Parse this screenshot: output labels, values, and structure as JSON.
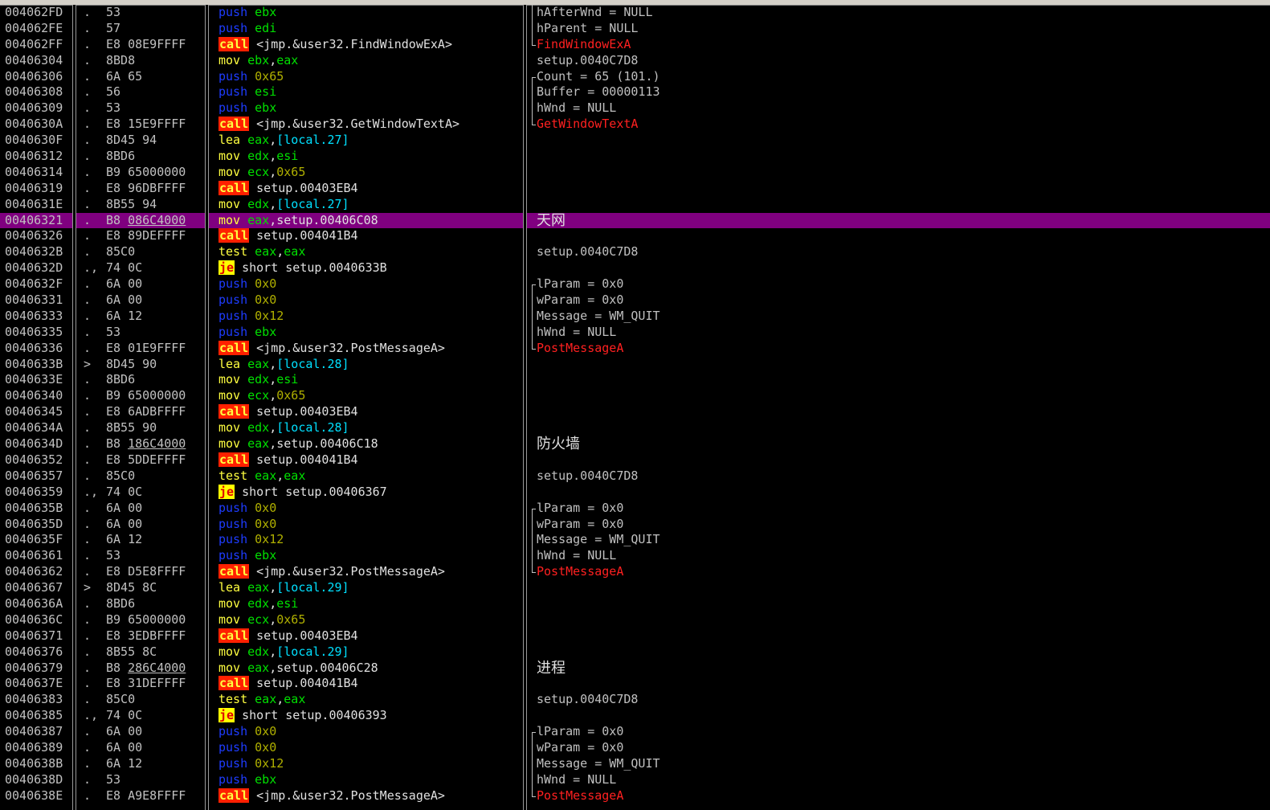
{
  "rows": [
    {
      "addr": "004062FD",
      "mark": ".",
      "hex": "53",
      "ul": "",
      "mn": "push",
      "ops": [
        [
          "reg",
          "ebx"
        ]
      ],
      "cmt": "hAfterWnd = NULL",
      "ct": "txt",
      "br": "mid"
    },
    {
      "addr": "004062FE",
      "mark": ".",
      "hex": "57",
      "ul": "",
      "mn": "push",
      "ops": [
        [
          "reg",
          "edi"
        ]
      ],
      "cmt": "hParent = NULL",
      "ct": "txt",
      "br": "mid"
    },
    {
      "addr": "004062FF",
      "mark": ".",
      "hex": "E8 08E9FFFF",
      "ul": "",
      "mn": "call",
      "ops": [
        [
          "txt",
          "<jmp.&user32.FindWindowExA>"
        ]
      ],
      "cmt": "FindWindowExA",
      "ct": "api",
      "br": "bot"
    },
    {
      "addr": "00406304",
      "mark": ".",
      "hex": "8BD8",
      "ul": "",
      "mn": "mov",
      "ops": [
        [
          "reg",
          "ebx"
        ],
        [
          "txt",
          ","
        ],
        [
          "reg",
          "eax"
        ]
      ],
      "cmt": "setup.0040C7D8",
      "ct": "txt",
      "br": "none"
    },
    {
      "addr": "00406306",
      "mark": ".",
      "hex": "6A 65",
      "ul": "",
      "mn": "push",
      "ops": [
        [
          "num",
          "0x65"
        ]
      ],
      "cmt": "Count = 65 (101.)",
      "ct": "txt",
      "br": "top"
    },
    {
      "addr": "00406308",
      "mark": ".",
      "hex": "56",
      "ul": "",
      "mn": "push",
      "ops": [
        [
          "reg",
          "esi"
        ]
      ],
      "cmt": "Buffer = 00000113",
      "ct": "txt",
      "br": "mid"
    },
    {
      "addr": "00406309",
      "mark": ".",
      "hex": "53",
      "ul": "",
      "mn": "push",
      "ops": [
        [
          "reg",
          "ebx"
        ]
      ],
      "cmt": "hWnd = NULL",
      "ct": "txt",
      "br": "mid"
    },
    {
      "addr": "0040630A",
      "mark": ".",
      "hex": "E8 15E9FFFF",
      "ul": "",
      "mn": "call",
      "ops": [
        [
          "txt",
          "<jmp.&user32.GetWindowTextA>"
        ]
      ],
      "cmt": "GetWindowTextA",
      "ct": "api",
      "br": "bot"
    },
    {
      "addr": "0040630F",
      "mark": ".",
      "hex": "8D45 94",
      "ul": "",
      "mn": "lea",
      "ops": [
        [
          "reg",
          "eax"
        ],
        [
          "txt",
          ","
        ],
        [
          "mem",
          "[local.27]"
        ]
      ],
      "cmt": "",
      "ct": "txt",
      "br": "none"
    },
    {
      "addr": "00406312",
      "mark": ".",
      "hex": "8BD6",
      "ul": "",
      "mn": "mov",
      "ops": [
        [
          "reg",
          "edx"
        ],
        [
          "txt",
          ","
        ],
        [
          "reg",
          "esi"
        ]
      ],
      "cmt": "",
      "ct": "txt",
      "br": "none"
    },
    {
      "addr": "00406314",
      "mark": ".",
      "hex": "B9 65000000",
      "ul": "",
      "mn": "mov",
      "ops": [
        [
          "reg",
          "ecx"
        ],
        [
          "txt",
          ","
        ],
        [
          "num",
          "0x65"
        ]
      ],
      "cmt": "",
      "ct": "txt",
      "br": "none"
    },
    {
      "addr": "00406319",
      "mark": ".",
      "hex": "E8 96DBFFFF",
      "ul": "",
      "mn": "call",
      "ops": [
        [
          "txt",
          "setup.00403EB4"
        ]
      ],
      "cmt": "",
      "ct": "txt",
      "br": "none"
    },
    {
      "addr": "0040631E",
      "mark": ".",
      "hex": "8B55 94",
      "ul": "",
      "mn": "mov",
      "ops": [
        [
          "reg",
          "edx"
        ],
        [
          "txt",
          ","
        ],
        [
          "mem",
          "[local.27]"
        ]
      ],
      "cmt": "",
      "ct": "txt",
      "br": "none"
    },
    {
      "addr": "00406321",
      "mark": ".",
      "hex": "B8 ",
      "ul": "086C4000",
      "mn": "mov",
      "ops": [
        [
          "reg",
          "eax"
        ],
        [
          "txt",
          ",setup.00406C08"
        ]
      ],
      "cmt": "天网",
      "ct": "cn",
      "br": "none",
      "sel": true
    },
    {
      "addr": "00406326",
      "mark": ".",
      "hex": "E8 89DEFFFF",
      "ul": "",
      "mn": "call",
      "ops": [
        [
          "txt",
          "setup.004041B4"
        ]
      ],
      "cmt": "",
      "ct": "txt",
      "br": "none"
    },
    {
      "addr": "0040632B",
      "mark": ".",
      "hex": "85C0",
      "ul": "",
      "mn": "test",
      "ops": [
        [
          "reg",
          "eax"
        ],
        [
          "txt",
          ","
        ],
        [
          "reg",
          "eax"
        ]
      ],
      "cmt": "setup.0040C7D8",
      "ct": "txt",
      "br": "none"
    },
    {
      "addr": "0040632D",
      "mark": ".,",
      "hex": "74 0C",
      "ul": "",
      "mn": "je",
      "ops": [
        [
          "txt",
          "short setup.0040633B"
        ]
      ],
      "cmt": "",
      "ct": "txt",
      "br": "none"
    },
    {
      "addr": "0040632F",
      "mark": ".",
      "hex": "6A 00",
      "ul": "",
      "mn": "push",
      "ops": [
        [
          "num",
          "0x0"
        ]
      ],
      "cmt": "lParam = 0x0",
      "ct": "txt",
      "br": "top"
    },
    {
      "addr": "00406331",
      "mark": ".",
      "hex": "6A 00",
      "ul": "",
      "mn": "push",
      "ops": [
        [
          "num",
          "0x0"
        ]
      ],
      "cmt": "wParam = 0x0",
      "ct": "txt",
      "br": "mid"
    },
    {
      "addr": "00406333",
      "mark": ".",
      "hex": "6A 12",
      "ul": "",
      "mn": "push",
      "ops": [
        [
          "num",
          "0x12"
        ]
      ],
      "cmt": "Message = WM_QUIT",
      "ct": "txt",
      "br": "mid"
    },
    {
      "addr": "00406335",
      "mark": ".",
      "hex": "53",
      "ul": "",
      "mn": "push",
      "ops": [
        [
          "reg",
          "ebx"
        ]
      ],
      "cmt": "hWnd = NULL",
      "ct": "txt",
      "br": "mid"
    },
    {
      "addr": "00406336",
      "mark": ".",
      "hex": "E8 01E9FFFF",
      "ul": "",
      "mn": "call",
      "ops": [
        [
          "txt",
          "<jmp.&user32.PostMessageA>"
        ]
      ],
      "cmt": "PostMessageA",
      "ct": "api",
      "br": "bot"
    },
    {
      "addr": "0040633B",
      "mark": ">",
      "hex": "8D45 90",
      "ul": "",
      "mn": "lea",
      "ops": [
        [
          "reg",
          "eax"
        ],
        [
          "txt",
          ","
        ],
        [
          "mem",
          "[local.28]"
        ]
      ],
      "cmt": "",
      "ct": "txt",
      "br": "none"
    },
    {
      "addr": "0040633E",
      "mark": ".",
      "hex": "8BD6",
      "ul": "",
      "mn": "mov",
      "ops": [
        [
          "reg",
          "edx"
        ],
        [
          "txt",
          ","
        ],
        [
          "reg",
          "esi"
        ]
      ],
      "cmt": "",
      "ct": "txt",
      "br": "none"
    },
    {
      "addr": "00406340",
      "mark": ".",
      "hex": "B9 65000000",
      "ul": "",
      "mn": "mov",
      "ops": [
        [
          "reg",
          "ecx"
        ],
        [
          "txt",
          ","
        ],
        [
          "num",
          "0x65"
        ]
      ],
      "cmt": "",
      "ct": "txt",
      "br": "none"
    },
    {
      "addr": "00406345",
      "mark": ".",
      "hex": "E8 6ADBFFFF",
      "ul": "",
      "mn": "call",
      "ops": [
        [
          "txt",
          "setup.00403EB4"
        ]
      ],
      "cmt": "",
      "ct": "txt",
      "br": "none"
    },
    {
      "addr": "0040634A",
      "mark": ".",
      "hex": "8B55 90",
      "ul": "",
      "mn": "mov",
      "ops": [
        [
          "reg",
          "edx"
        ],
        [
          "txt",
          ","
        ],
        [
          "mem",
          "[local.28]"
        ]
      ],
      "cmt": "",
      "ct": "txt",
      "br": "none"
    },
    {
      "addr": "0040634D",
      "mark": ".",
      "hex": "B8 ",
      "ul": "186C4000",
      "mn": "mov",
      "ops": [
        [
          "reg",
          "eax"
        ],
        [
          "txt",
          ",setup.00406C18"
        ]
      ],
      "cmt": "防火墙",
      "ct": "cn",
      "br": "none"
    },
    {
      "addr": "00406352",
      "mark": ".",
      "hex": "E8 5DDEFFFF",
      "ul": "",
      "mn": "call",
      "ops": [
        [
          "txt",
          "setup.004041B4"
        ]
      ],
      "cmt": "",
      "ct": "txt",
      "br": "none"
    },
    {
      "addr": "00406357",
      "mark": ".",
      "hex": "85C0",
      "ul": "",
      "mn": "test",
      "ops": [
        [
          "reg",
          "eax"
        ],
        [
          "txt",
          ","
        ],
        [
          "reg",
          "eax"
        ]
      ],
      "cmt": "setup.0040C7D8",
      "ct": "txt",
      "br": "none"
    },
    {
      "addr": "00406359",
      "mark": ".,",
      "hex": "74 0C",
      "ul": "",
      "mn": "je",
      "ops": [
        [
          "txt",
          "short setup.00406367"
        ]
      ],
      "cmt": "",
      "ct": "txt",
      "br": "none"
    },
    {
      "addr": "0040635B",
      "mark": ".",
      "hex": "6A 00",
      "ul": "",
      "mn": "push",
      "ops": [
        [
          "num",
          "0x0"
        ]
      ],
      "cmt": "lParam = 0x0",
      "ct": "txt",
      "br": "top"
    },
    {
      "addr": "0040635D",
      "mark": ".",
      "hex": "6A 00",
      "ul": "",
      "mn": "push",
      "ops": [
        [
          "num",
          "0x0"
        ]
      ],
      "cmt": "wParam = 0x0",
      "ct": "txt",
      "br": "mid"
    },
    {
      "addr": "0040635F",
      "mark": ".",
      "hex": "6A 12",
      "ul": "",
      "mn": "push",
      "ops": [
        [
          "num",
          "0x12"
        ]
      ],
      "cmt": "Message = WM_QUIT",
      "ct": "txt",
      "br": "mid"
    },
    {
      "addr": "00406361",
      "mark": ".",
      "hex": "53",
      "ul": "",
      "mn": "push",
      "ops": [
        [
          "reg",
          "ebx"
        ]
      ],
      "cmt": "hWnd = NULL",
      "ct": "txt",
      "br": "mid"
    },
    {
      "addr": "00406362",
      "mark": ".",
      "hex": "E8 D5E8FFFF",
      "ul": "",
      "mn": "call",
      "ops": [
        [
          "txt",
          "<jmp.&user32.PostMessageA>"
        ]
      ],
      "cmt": "PostMessageA",
      "ct": "api",
      "br": "bot"
    },
    {
      "addr": "00406367",
      "mark": ">",
      "hex": "8D45 8C",
      "ul": "",
      "mn": "lea",
      "ops": [
        [
          "reg",
          "eax"
        ],
        [
          "txt",
          ","
        ],
        [
          "mem",
          "[local.29]"
        ]
      ],
      "cmt": "",
      "ct": "txt",
      "br": "none"
    },
    {
      "addr": "0040636A",
      "mark": ".",
      "hex": "8BD6",
      "ul": "",
      "mn": "mov",
      "ops": [
        [
          "reg",
          "edx"
        ],
        [
          "txt",
          ","
        ],
        [
          "reg",
          "esi"
        ]
      ],
      "cmt": "",
      "ct": "txt",
      "br": "none"
    },
    {
      "addr": "0040636C",
      "mark": ".",
      "hex": "B9 65000000",
      "ul": "",
      "mn": "mov",
      "ops": [
        [
          "reg",
          "ecx"
        ],
        [
          "txt",
          ","
        ],
        [
          "num",
          "0x65"
        ]
      ],
      "cmt": "",
      "ct": "txt",
      "br": "none"
    },
    {
      "addr": "00406371",
      "mark": ".",
      "hex": "E8 3EDBFFFF",
      "ul": "",
      "mn": "call",
      "ops": [
        [
          "txt",
          "setup.00403EB4"
        ]
      ],
      "cmt": "",
      "ct": "txt",
      "br": "none"
    },
    {
      "addr": "00406376",
      "mark": ".",
      "hex": "8B55 8C",
      "ul": "",
      "mn": "mov",
      "ops": [
        [
          "reg",
          "edx"
        ],
        [
          "txt",
          ","
        ],
        [
          "mem",
          "[local.29]"
        ]
      ],
      "cmt": "",
      "ct": "txt",
      "br": "none"
    },
    {
      "addr": "00406379",
      "mark": ".",
      "hex": "B8 ",
      "ul": "286C4000",
      "mn": "mov",
      "ops": [
        [
          "reg",
          "eax"
        ],
        [
          "txt",
          ",setup.00406C28"
        ]
      ],
      "cmt": "进程",
      "ct": "cn",
      "br": "none"
    },
    {
      "addr": "0040637E",
      "mark": ".",
      "hex": "E8 31DEFFFF",
      "ul": "",
      "mn": "call",
      "ops": [
        [
          "txt",
          "setup.004041B4"
        ]
      ],
      "cmt": "",
      "ct": "txt",
      "br": "none"
    },
    {
      "addr": "00406383",
      "mark": ".",
      "hex": "85C0",
      "ul": "",
      "mn": "test",
      "ops": [
        [
          "reg",
          "eax"
        ],
        [
          "txt",
          ","
        ],
        [
          "reg",
          "eax"
        ]
      ],
      "cmt": "setup.0040C7D8",
      "ct": "txt",
      "br": "none"
    },
    {
      "addr": "00406385",
      "mark": ".,",
      "hex": "74 0C",
      "ul": "",
      "mn": "je",
      "ops": [
        [
          "txt",
          "short setup.00406393"
        ]
      ],
      "cmt": "",
      "ct": "txt",
      "br": "none"
    },
    {
      "addr": "00406387",
      "mark": ".",
      "hex": "6A 00",
      "ul": "",
      "mn": "push",
      "ops": [
        [
          "num",
          "0x0"
        ]
      ],
      "cmt": "lParam = 0x0",
      "ct": "txt",
      "br": "top"
    },
    {
      "addr": "00406389",
      "mark": ".",
      "hex": "6A 00",
      "ul": "",
      "mn": "push",
      "ops": [
        [
          "num",
          "0x0"
        ]
      ],
      "cmt": "wParam = 0x0",
      "ct": "txt",
      "br": "mid"
    },
    {
      "addr": "0040638B",
      "mark": ".",
      "hex": "6A 12",
      "ul": "",
      "mn": "push",
      "ops": [
        [
          "num",
          "0x12"
        ]
      ],
      "cmt": "Message = WM_QUIT",
      "ct": "txt",
      "br": "mid"
    },
    {
      "addr": "0040638D",
      "mark": ".",
      "hex": "53",
      "ul": "",
      "mn": "push",
      "ops": [
        [
          "reg",
          "ebx"
        ]
      ],
      "cmt": "hWnd = NULL",
      "ct": "txt",
      "br": "mid"
    },
    {
      "addr": "0040638E",
      "mark": ".",
      "hex": "E8 A9E8FFFF",
      "ul": "",
      "mn": "call",
      "ops": [
        [
          "txt",
          "<jmp.&user32.PostMessageA>"
        ]
      ],
      "cmt": "PostMessageA",
      "ct": "api",
      "br": "bot"
    }
  ]
}
